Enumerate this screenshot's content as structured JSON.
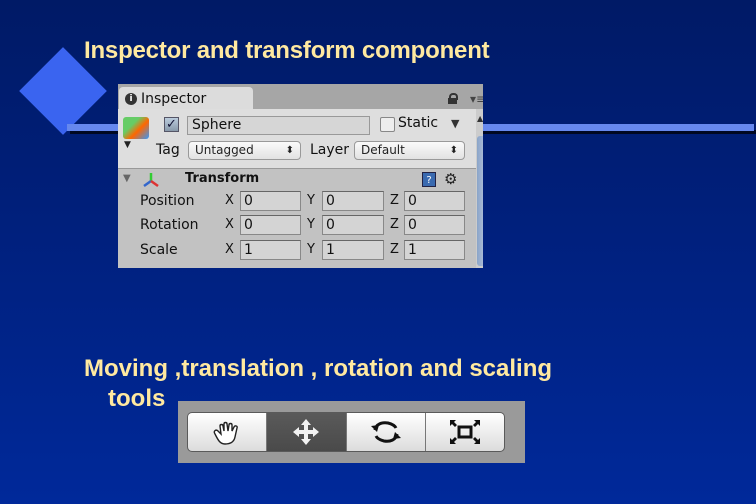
{
  "slide": {
    "title": "Inspector and transform component",
    "subtitle_line1": "Moving ,translation , rotation and scaling",
    "subtitle_line2": "tools"
  },
  "inspector": {
    "tab_label": "Inspector",
    "object_name": "Sphere",
    "active_checked": true,
    "static_label": "Static",
    "static_checked": false,
    "tag_label": "Tag",
    "tag_value": "Untagged",
    "layer_label": "Layer",
    "layer_value": "Default",
    "component_title": "Transform",
    "rows": [
      {
        "label": "Position",
        "x": "0",
        "y": "0",
        "z": "0"
      },
      {
        "label": "Rotation",
        "x": "0",
        "y": "0",
        "z": "0"
      },
      {
        "label": "Scale",
        "x": "1",
        "y": "1",
        "z": "1"
      }
    ],
    "axis_labels": {
      "x": "X",
      "y": "Y",
      "z": "Z"
    },
    "check_glyph": "✓",
    "info_glyph": "i",
    "help_glyph": "?",
    "gear_glyph": "⚙",
    "popup_arrow": "⬍",
    "fold_glyph": "▼",
    "dropdown_glyph": "▼",
    "menu_glyph": "▾≡"
  },
  "toolbar": {
    "tools": [
      {
        "name": "hand-tool",
        "icon": "hand-icon",
        "active": false
      },
      {
        "name": "move-tool",
        "icon": "move-arrows-icon",
        "active": true
      },
      {
        "name": "rotate-tool",
        "icon": "rotate-icon",
        "active": false
      },
      {
        "name": "scale-tool",
        "icon": "scale-icon",
        "active": false
      }
    ]
  },
  "colors": {
    "title_text": "#ffe9a0",
    "background": "#001f7a",
    "accent_diamond": "#3a64f0",
    "rule": "#6688ee"
  }
}
